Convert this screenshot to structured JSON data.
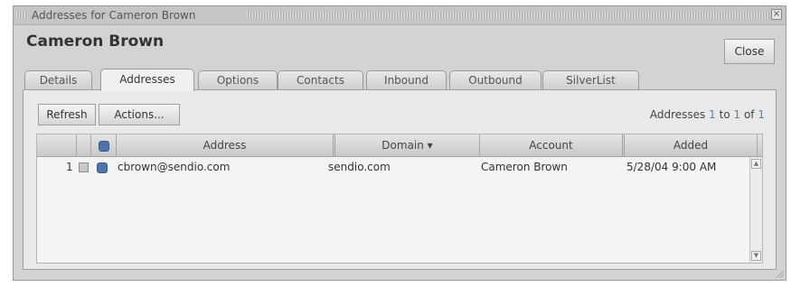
{
  "window": {
    "title": "Addresses for Cameron Brown",
    "close_glyph": "×"
  },
  "user_name": "Cameron Brown",
  "close_button": "Close",
  "tabs": [
    {
      "label": "Details",
      "active": false
    },
    {
      "label": "Addresses",
      "active": true
    },
    {
      "label": "Options",
      "active": false
    },
    {
      "label": "Contacts",
      "active": false
    },
    {
      "label": "Inbound",
      "active": false
    },
    {
      "label": "Outbound",
      "active": false
    },
    {
      "label": "SilverList",
      "active": false
    }
  ],
  "toolbar": {
    "refresh": "Refresh",
    "actions": "Actions..."
  },
  "pagination": {
    "prefix": "Addresses",
    "from": "1",
    "to_word": "to",
    "to": "1",
    "of_word": "of",
    "total": "1"
  },
  "table": {
    "columns": {
      "address": "Address",
      "domain": "Domain ▾",
      "account": "Account",
      "added": "Added"
    },
    "rows": [
      {
        "index": "1",
        "address": "cbrown@sendio.com",
        "domain": "sendio.com",
        "account": "Cameron Brown",
        "added": "5/28/04 9:00 AM"
      }
    ]
  },
  "colors": {
    "accent_blue": "#4f74aa",
    "window_bg": "#d3d3d3",
    "panel_bg": "#e9e9e9"
  },
  "icons": {
    "status_header": "status-icon",
    "row_checkbox": "checkbox-icon",
    "row_status": "status-icon",
    "scroll_up": "arrow-up-icon",
    "scroll_down": "arrow-down-icon"
  }
}
